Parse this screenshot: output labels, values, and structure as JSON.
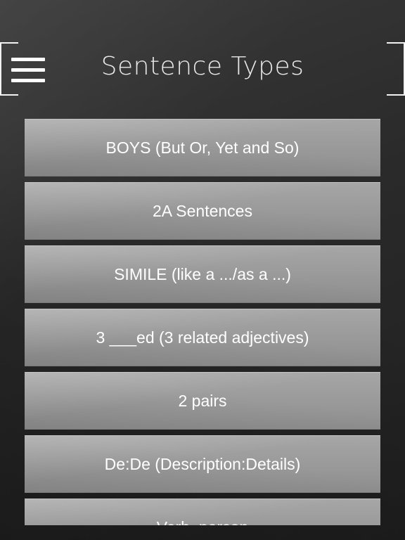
{
  "header": {
    "title": "Sentence Types",
    "menu_icon": "hamburger-icon"
  },
  "sentence_types": [
    {
      "label": "BOYS (But Or, Yet and So)"
    },
    {
      "label": "2A Sentences"
    },
    {
      "label": "SIMILE (like a .../as a ...)"
    },
    {
      "label": "3 ___ed (3 related adjectives)"
    },
    {
      "label": "2 pairs"
    },
    {
      "label": "De:De (Description:Details)"
    },
    {
      "label": "Verb, person"
    }
  ],
  "colors": {
    "background": "#2b2b2b",
    "item_background": "#9a9a9a",
    "text": "#ffffff",
    "title": "#e8e8e8"
  }
}
